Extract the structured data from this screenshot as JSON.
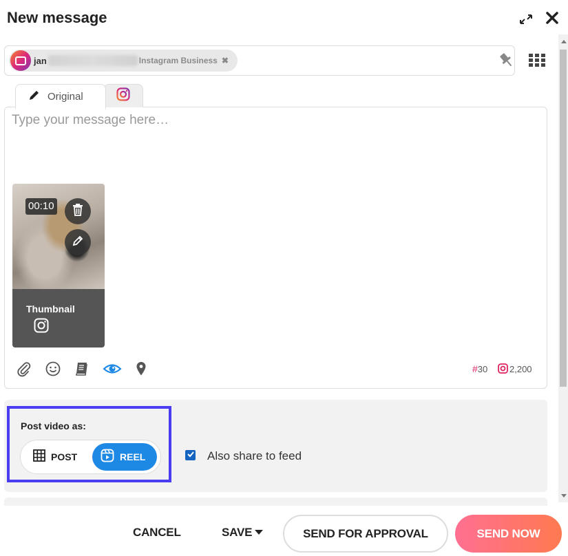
{
  "header": {
    "title": "New message"
  },
  "recipient": {
    "name_prefix": "jan",
    "network": "Instagram Business",
    "remove_symbol": "✖"
  },
  "tabs": {
    "original_label": "Original",
    "instagram_tab": "instagram-icon"
  },
  "composer": {
    "placeholder": "Type your message here…",
    "media": {
      "duration": "00:10",
      "thumbnail_label": "Thumbnail"
    },
    "counters": {
      "hashtag_symbol": "#",
      "hashtag_count": "30",
      "instagram_chars": "2,200"
    },
    "toolbar_icons": [
      "paperclip-icon",
      "emoji-icon",
      "library-icon",
      "preview-eye-icon",
      "location-pin-icon"
    ]
  },
  "options": {
    "post_video_label": "Post video as:",
    "post_option": "POST",
    "reel_option": "REEL",
    "selected": "REEL",
    "feed_checkbox_label": "Also share to feed",
    "feed_checked": true
  },
  "footer": {
    "cancel": "CANCEL",
    "save": "SAVE",
    "send_for_approval": "SEND FOR APPROVAL",
    "send_now": "SEND NOW"
  },
  "colors": {
    "accent_blue": "#1e88e5",
    "highlight": "#4a3cf0",
    "send_gradient_start": "#ff6f91",
    "send_gradient_end": "#ff7a50",
    "hashtag_red": "#e0245e"
  }
}
